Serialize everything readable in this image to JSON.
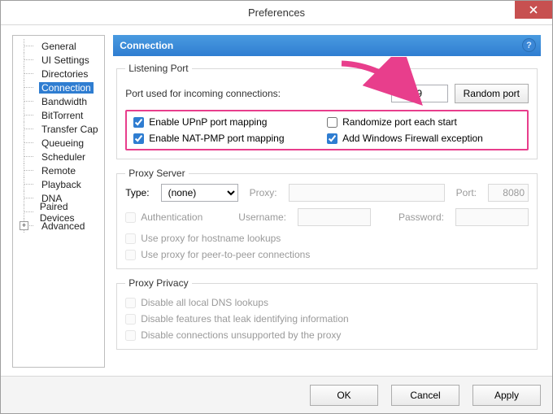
{
  "window": {
    "title": "Preferences"
  },
  "tree": {
    "items": [
      {
        "label": "General"
      },
      {
        "label": "UI Settings"
      },
      {
        "label": "Directories"
      },
      {
        "label": "Connection",
        "selected": true
      },
      {
        "label": "Bandwidth"
      },
      {
        "label": "BitTorrent"
      },
      {
        "label": "Transfer Cap"
      },
      {
        "label": "Queueing"
      },
      {
        "label": "Scheduler"
      },
      {
        "label": "Remote"
      },
      {
        "label": "Playback"
      },
      {
        "label": "DNA"
      },
      {
        "label": "Paired Devices"
      },
      {
        "label": "Advanced",
        "expandable": true
      }
    ]
  },
  "pane": {
    "title": "Connection",
    "help_symbol": "?",
    "listening": {
      "legend": "Listening Port",
      "port_label": "Port used for incoming connections:",
      "port_value": "37939",
      "random_btn": "Random port",
      "upnp": "Enable UPnP port mapping",
      "natpmp": "Enable NAT-PMP port mapping",
      "randomize": "Randomize port each start",
      "firewall": "Add Windows Firewall exception"
    },
    "proxy": {
      "legend": "Proxy Server",
      "type_label": "Type:",
      "type_value": "(none)",
      "proxy_label": "Proxy:",
      "port_label": "Port:",
      "port_value": "8080",
      "auth": "Authentication",
      "user_label": "Username:",
      "pass_label": "Password:",
      "hostname": "Use proxy for hostname lookups",
      "p2p": "Use proxy for peer-to-peer connections"
    },
    "privacy": {
      "legend": "Proxy Privacy",
      "dns": "Disable all local DNS lookups",
      "leak": "Disable features that leak identifying information",
      "unsupported": "Disable connections unsupported by the proxy"
    }
  },
  "footer": {
    "ok": "OK",
    "cancel": "Cancel",
    "apply": "Apply"
  }
}
